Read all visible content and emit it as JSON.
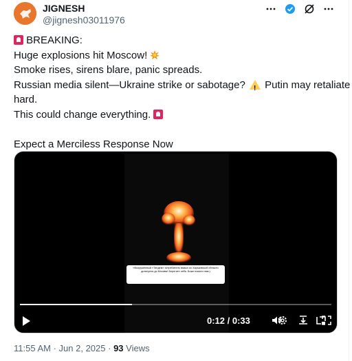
{
  "author": {
    "name": "JIGNESH",
    "handle": "@jignesh03011976",
    "avatar_label": "SUPER HERO"
  },
  "header_icons": [
    "more-icon",
    "verified-badge-icon",
    "grok-icon",
    "more-options-icon"
  ],
  "tweet": {
    "line1": "BREAKING:",
    "line2": "Huge explosions hit Moscow!",
    "line3": "Smoke rises, sirens blare, panic spreads.",
    "line4a": "Russian media silent—Ukraine strike or sabotage?",
    "line4b": "Putin may retaliate",
    "line5": "hard.",
    "line6": "This could change everything.",
    "line7": "Expect a Merciless Response Now"
  },
  "video": {
    "caption": "«Вооружённый «Тандем» истребитель взмыл из Харьковской области дотянулся до Москвы! Берегите себя. Боже помоги нам.)",
    "time_current": "0:12",
    "time_total": "0:33",
    "time_display": "0:12 / 0:33",
    "progress": 0.36
  },
  "meta": {
    "time": "11:55 AM",
    "date": "Jun 2, 2025",
    "views_count": "93",
    "views_label": "Views"
  },
  "colors": {
    "accent": "#1d9bf0",
    "avatar": "#e8762d",
    "secondary_text": "#536471"
  }
}
